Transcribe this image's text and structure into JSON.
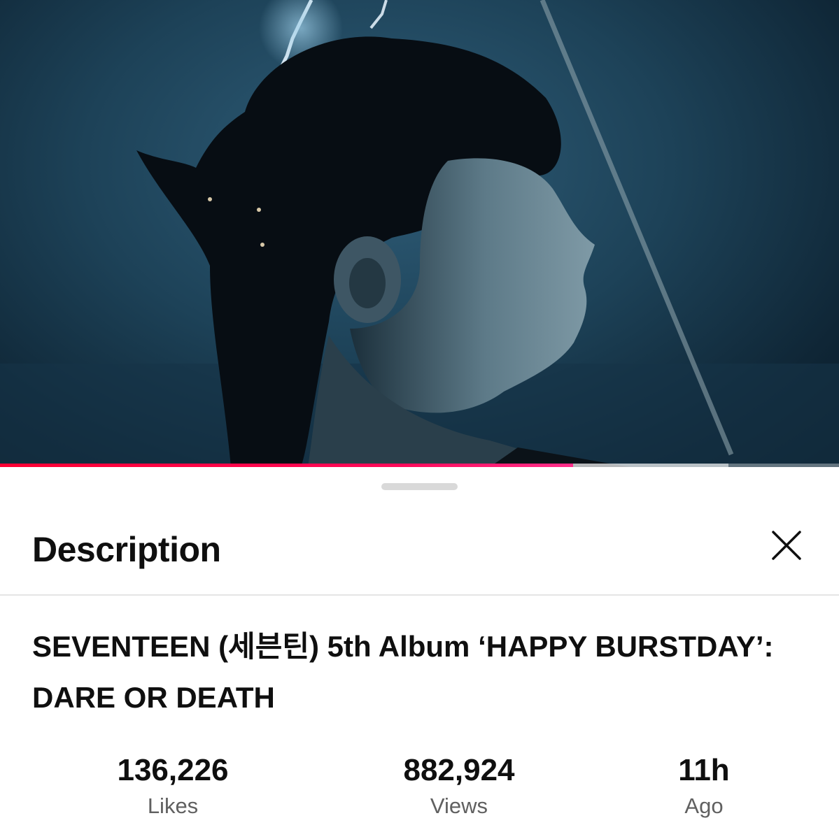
{
  "video": {
    "playback_progress": 0.683,
    "buffered_progress": 0.868
  },
  "colors": {
    "progress": "#ff0033",
    "text_primary": "#0f0f0f",
    "text_secondary": "#606060"
  },
  "sheet": {
    "title": "Description",
    "close_icon": "close-icon"
  },
  "video_title": "SEVENTEEN (세븐틴) 5th Album ‘HAPPY BURSTDAY’: DARE OR DEATH",
  "stats": [
    {
      "value": "136,226",
      "label": "Likes"
    },
    {
      "value": "882,924",
      "label": "Views"
    },
    {
      "value": "11h",
      "label": "Ago"
    }
  ]
}
